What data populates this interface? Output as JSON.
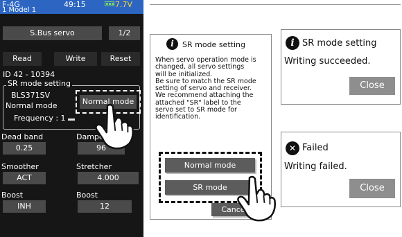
{
  "transmitter": {
    "status": {
      "model_code": "F-4G",
      "time": "49:15",
      "voltage": "7.7V",
      "model_name": "1  Model 1"
    },
    "header": {
      "title": "S.Bus servo",
      "page": "1/2"
    },
    "actions": {
      "read": "Read",
      "write": "Write",
      "reset": "Reset"
    },
    "id_line": "ID   42  -  10394",
    "sr_group": {
      "title": "SR mode setting",
      "servo_model": "BLS371SV",
      "current_mode": "Normal mode",
      "mode_button": "Normal mode",
      "frequency_label": "Frequency : 1"
    },
    "params": [
      {
        "label": "Dead band",
        "value": "0.25"
      },
      {
        "label": "Damper",
        "value": "96"
      },
      {
        "label": "Smoother",
        "value": "ACT"
      },
      {
        "label": "Stretcher",
        "value": "4.000"
      },
      {
        "label": "Boost",
        "value": "INH"
      },
      {
        "label": "Boost",
        "value": "12"
      }
    ]
  },
  "sr_dialog": {
    "title": "SR mode setting",
    "paragraphs": [
      " When servo operation mode is\nchanged, all servo settings\nwill be initialized.",
      " Be sure to match the SR mode\nsetting of servo and receiver.",
      " We recommend attaching the\nattached \"SR\" label to the\nservo set to SR mode for\nidentification."
    ],
    "normal_button": "Normal mode",
    "sr_button": "SR mode",
    "cancel_button": "Cancel"
  },
  "success_dialog": {
    "title": "SR mode setting",
    "message": "Writing succeeded.",
    "close_label": "Close"
  },
  "failed_dialog": {
    "title": "Failed",
    "message": "Writing failed.",
    "close_label": "Close"
  },
  "colors": {
    "status_bar": "#2c66c2",
    "screen_bg": "#161616",
    "button_gray": "#4a4a4a",
    "voltage": "#ffd030",
    "battery": "#7cd06b"
  },
  "icons": [
    "info-icon",
    "error-x-icon",
    "battery-icon",
    "pointing-hand-icon"
  ]
}
